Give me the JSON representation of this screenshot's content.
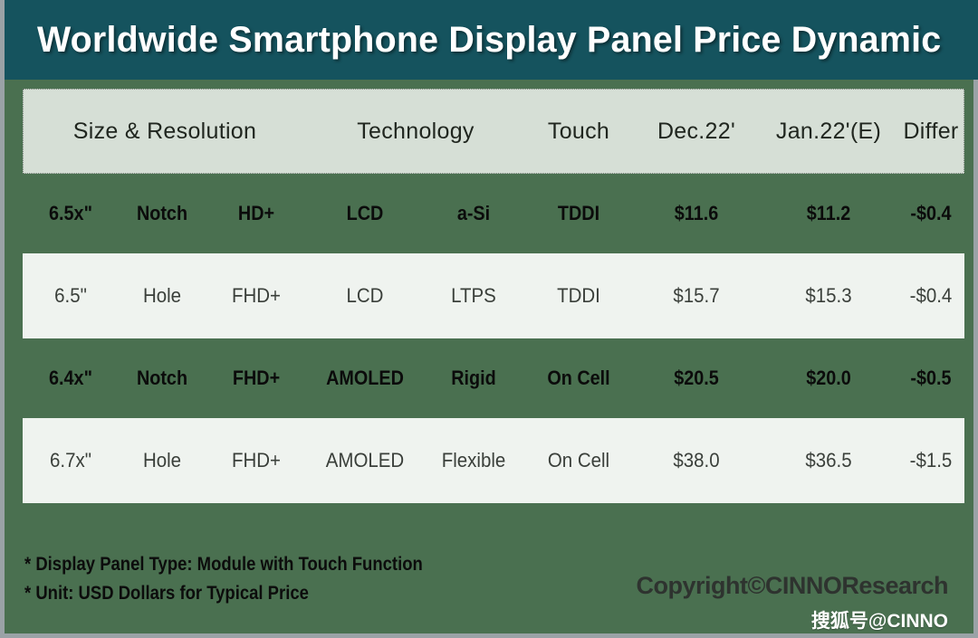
{
  "title": "Worldwide Smartphone Display Panel Price Dynamic",
  "table": {
    "headers": [
      "Size & Resolution",
      "Technology",
      "Touch",
      "Dec.22'",
      "Jan.22'(E)",
      "Differ"
    ],
    "rows": [
      {
        "style": "dark",
        "cells": [
          "6.5x\"",
          "Notch",
          "HD+",
          "LCD",
          "a-Si",
          "TDDI",
          "$11.6",
          "$11.2",
          "-$0.4"
        ]
      },
      {
        "style": "light",
        "cells": [
          "6.5\"",
          "Hole",
          "FHD+",
          "LCD",
          "LTPS",
          "TDDI",
          "$15.7",
          "$15.3",
          "-$0.4"
        ]
      },
      {
        "style": "dark",
        "cells": [
          "6.4x\"",
          "Notch",
          "FHD+",
          "AMOLED",
          "Rigid",
          "On Cell",
          "$20.5",
          "$20.0",
          "-$0.5"
        ]
      },
      {
        "style": "light",
        "cells": [
          "6.7x\"",
          "Hole",
          "FHD+",
          "AMOLED",
          "Flexible",
          "On Cell",
          "$38.0",
          "$36.5",
          "-$1.5"
        ]
      }
    ]
  },
  "notes": [
    "* Display Panel Type:  Module with Touch Function",
    "* Unit:  USD Dollars for Typical Price"
  ],
  "watermarks": {
    "copyright": "Copyright©CINNOResearch",
    "sohu": "搜狐号@CINNO"
  },
  "colors": {
    "title_bar": "#15535e",
    "page_background": "#4a7050",
    "header_row": "#d6dfd6",
    "light_row": "#eff3ef",
    "border": "#9aa2a6"
  }
}
